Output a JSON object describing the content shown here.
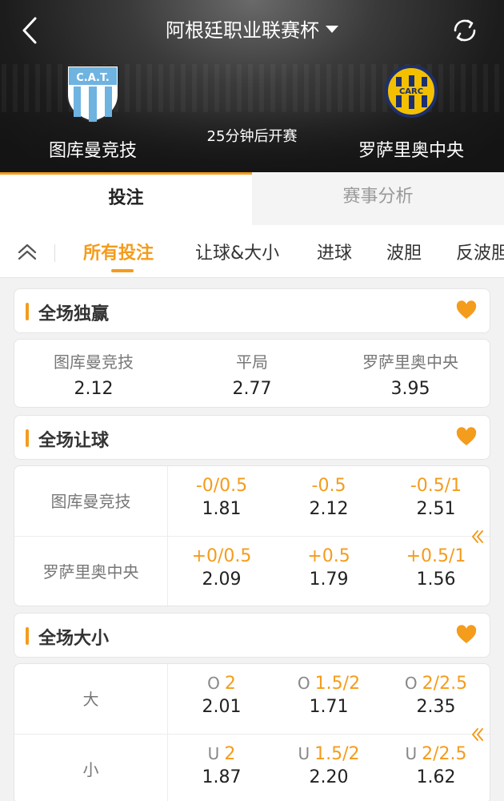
{
  "header": {
    "league_title": "阿根廷职业联赛杯",
    "kickoff_text": "25分钟后开赛",
    "home_team": {
      "name": "图库曼竞技",
      "logo_text": "C.A.T."
    },
    "away_team": {
      "name": "罗萨里奥中央",
      "logo_text": "CARC"
    }
  },
  "main_tabs": [
    {
      "label": "投注",
      "active": true
    },
    {
      "label": "赛事分析",
      "active": false
    }
  ],
  "filter_tabs": [
    {
      "label": "所有投注",
      "active": true
    },
    {
      "label": "让球&大小",
      "active": false
    },
    {
      "label": "进球",
      "active": false
    },
    {
      "label": "波胆",
      "active": false
    },
    {
      "label": "反波胆",
      "active": false
    }
  ],
  "sections": {
    "full_time_1x2": {
      "title": "全场独赢",
      "options": [
        {
          "label": "图库曼竞技",
          "odd": "2.12"
        },
        {
          "label": "平局",
          "odd": "2.77"
        },
        {
          "label": "罗萨里奥中央",
          "odd": "3.95"
        }
      ]
    },
    "full_time_handicap": {
      "title": "全场让球",
      "rows": [
        {
          "team": "图库曼竞技",
          "cells": [
            {
              "line": "-0/0.5",
              "odd": "1.81"
            },
            {
              "line": "-0.5",
              "odd": "2.12"
            },
            {
              "line": "-0.5/1",
              "odd": "2.51"
            }
          ]
        },
        {
          "team": "罗萨里奥中央",
          "cells": [
            {
              "line": "+0/0.5",
              "odd": "2.09"
            },
            {
              "line": "+0.5",
              "odd": "1.79"
            },
            {
              "line": "+0.5/1",
              "odd": "1.56"
            }
          ]
        }
      ]
    },
    "full_time_total": {
      "title": "全场大小",
      "rows": [
        {
          "team": "大",
          "cells": [
            {
              "prefix": "O",
              "line": "2",
              "odd": "2.01"
            },
            {
              "prefix": "O",
              "line": "1.5/2",
              "odd": "1.71"
            },
            {
              "prefix": "O",
              "line": "2/2.5",
              "odd": "2.35"
            }
          ]
        },
        {
          "team": "小",
          "cells": [
            {
              "prefix": "U",
              "line": "2",
              "odd": "1.87"
            },
            {
              "prefix": "U",
              "line": "1.5/2",
              "odd": "2.20"
            },
            {
              "prefix": "U",
              "line": "2/2.5",
              "odd": "1.62"
            }
          ]
        }
      ]
    }
  },
  "colors": {
    "accent": "#f49c1c",
    "text": "#333333",
    "muted": "#777777"
  },
  "icons": [
    "back-arrow-icon",
    "caret-down-icon",
    "refresh-icon",
    "chevron-up-double-icon",
    "heart-icon",
    "chevron-left-double-icon"
  ]
}
